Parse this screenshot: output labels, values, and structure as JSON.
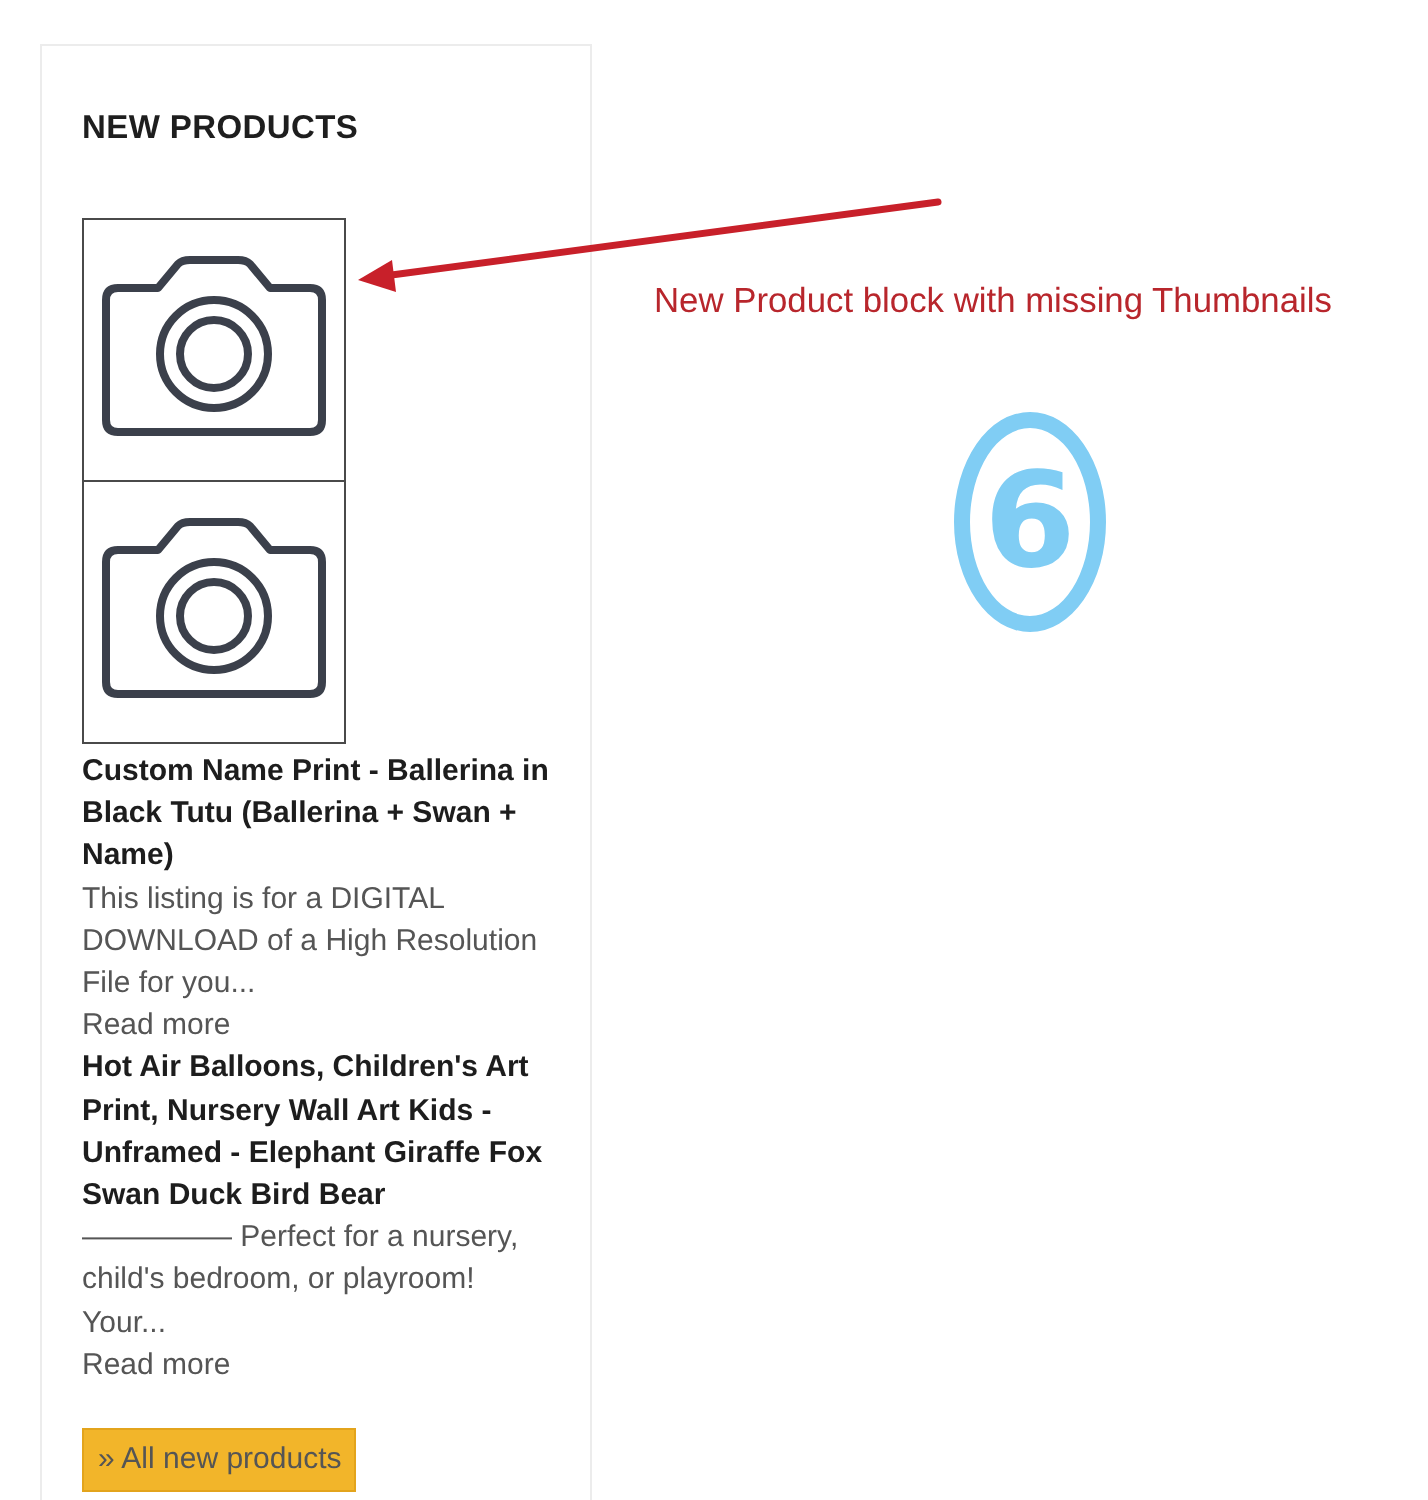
{
  "block": {
    "title": "NEW PRODUCTS",
    "products": [
      {
        "name": "Custom Name Print - Ballerina in Black Tutu (Ballerina + Swan + Name)",
        "description": "This listing is for a DIGITAL DOWNLOAD of a High Resolution File for you...",
        "read_more": "Read more"
      },
      {
        "name": "Hot Air Balloons, Children's Art Print, Nursery Wall Art Kids - Unframed - Elephant Giraffe Fox Swan Duck Bird Bear",
        "description": "————— Perfect for a nursery, child's bedroom, or playroom! Your...",
        "read_more": "Read more"
      }
    ],
    "all_button": "» All new products"
  },
  "annotation": {
    "text": "New Product block with missing Thumbnails",
    "number": "6"
  }
}
